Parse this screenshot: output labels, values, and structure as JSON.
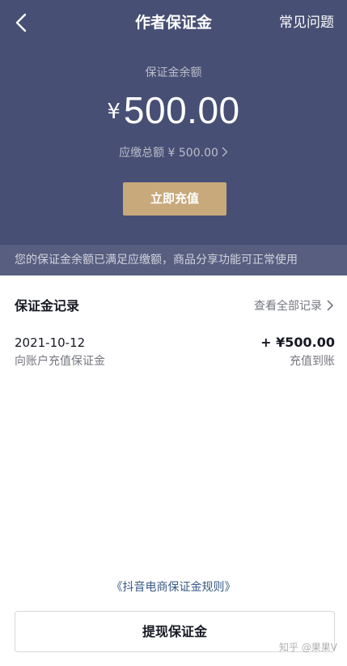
{
  "header": {
    "title": "作者保证金",
    "faq_label": "常见问题",
    "balance_label": "保证金余额",
    "currency_symbol": "¥",
    "balance_amount": "500.00",
    "total_due": "应缴总额 ¥ 500.00",
    "recharge_label": "立即充值",
    "bg_color": "#474f74",
    "accent_color": "#c8a97c"
  },
  "notice": {
    "text": "您的保证金余额已满足应缴额，商品分享功能可正常使用"
  },
  "records": {
    "title": "保证金记录",
    "view_all_label": "查看全部记录",
    "items": [
      {
        "date": "2021-10-12",
        "description": "向账户充值保证金",
        "amount": "+ ¥500.00",
        "status": "充值到账"
      }
    ]
  },
  "footer": {
    "rules_link": "《抖音电商保证金规则》",
    "withdraw_label": "提现保证金"
  },
  "watermark": "知乎 @果果V",
  "icons": {
    "back": "chevron-left-icon",
    "total_due_chevron": "chevron-right-icon",
    "view_all_chevron": "chevron-right-icon"
  }
}
